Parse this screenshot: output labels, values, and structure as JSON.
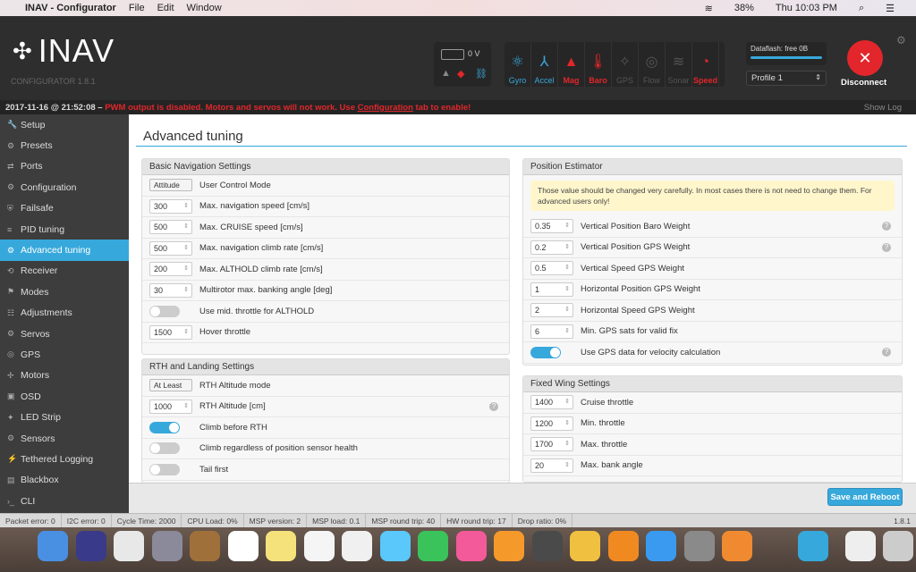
{
  "menubar": {
    "app": "INAV - Configurator",
    "items": [
      "File",
      "Edit",
      "Window"
    ],
    "battery": "38%",
    "clock": "Thu 10:03 PM"
  },
  "header": {
    "logo": "INAV",
    "subtitle": "CONFIGURATOR  1.8.1",
    "voltage": "0 V",
    "sensors": [
      {
        "label": "Gyro",
        "color": "#37a8db",
        "icon": "atom-icon",
        "glyph": "⚛"
      },
      {
        "label": "Accel",
        "color": "#37a8db",
        "icon": "axes-icon",
        "glyph": "⅄"
      },
      {
        "label": "Mag",
        "color": "#e2262b",
        "icon": "compass-n-icon",
        "glyph": "▲"
      },
      {
        "label": "Baro",
        "color": "#e2262b",
        "icon": "thermometer-icon",
        "glyph": "🌡"
      },
      {
        "label": "GPS",
        "color": "#555",
        "icon": "satellite-icon",
        "glyph": "✧"
      },
      {
        "label": "Flow",
        "color": "#555",
        "icon": "flow-icon",
        "glyph": "◎"
      },
      {
        "label": "Sonar",
        "color": "#555",
        "icon": "sonar-icon",
        "glyph": "≋"
      },
      {
        "label": "Speed",
        "color": "#e2262b",
        "icon": "speedometer-icon",
        "glyph": "◔"
      }
    ],
    "dataflash": "Dataflash: free 0B",
    "dataflash_fill": 1.0,
    "profile": "Profile 1",
    "disconnect": "Disconnect"
  },
  "log": {
    "timestamp": "2017-11-16 @ 21:52:08 –",
    "warning": "PWM output is disabled. Motors and servos will not work. Use",
    "link": "Configuration",
    "warning_end": "tab to enable!",
    "show_log": "Show Log"
  },
  "sidebar": {
    "items": [
      "Setup",
      "Presets",
      "Ports",
      "Configuration",
      "Failsafe",
      "PID tuning",
      "Advanced tuning",
      "Receiver",
      "Modes",
      "Adjustments",
      "Servos",
      "GPS",
      "Motors",
      "OSD",
      "LED Strip",
      "Sensors",
      "Tethered Logging",
      "Blackbox",
      "CLI"
    ],
    "active": 6
  },
  "page": {
    "title": "Advanced tuning",
    "save": "Save and Reboot"
  },
  "nav_settings": {
    "title": "Basic Navigation Settings",
    "rows": [
      {
        "type": "select",
        "value": "Attitude",
        "label": "User Control Mode"
      },
      {
        "type": "input",
        "value": "300",
        "label": "Max. navigation speed [cm/s]"
      },
      {
        "type": "input",
        "value": "500",
        "label": "Max. CRUISE speed [cm/s]"
      },
      {
        "type": "input",
        "value": "500",
        "label": "Max. navigation climb rate [cm/s]"
      },
      {
        "type": "input",
        "value": "200",
        "label": "Max. ALTHOLD climb rate [cm/s]"
      },
      {
        "type": "input",
        "value": "30",
        "label": "Multirotor max. banking angle [deg]"
      },
      {
        "type": "toggle",
        "on": false,
        "label": "Use mid. throttle for ALTHOLD"
      },
      {
        "type": "input",
        "value": "1500",
        "label": "Hover throttle"
      }
    ]
  },
  "rth_settings": {
    "title": "RTH and Landing Settings",
    "rows": [
      {
        "type": "select",
        "value": "At Least",
        "label": "RTH Altitude mode"
      },
      {
        "type": "input",
        "value": "1000",
        "label": "RTH Altitude [cm]",
        "help": true
      },
      {
        "type": "toggle",
        "on": true,
        "label": "Climb before RTH"
      },
      {
        "type": "toggle",
        "on": false,
        "label": "Climb regardless of position sensor health"
      },
      {
        "type": "toggle",
        "on": false,
        "label": "Tail first"
      }
    ]
  },
  "pos_estimator": {
    "title": "Position Estimator",
    "note": "Those value should be changed very carefully. In most cases there is not need to change them. For advanced users only!",
    "rows": [
      {
        "type": "input",
        "value": "0.35",
        "label": "Vertical Position Baro Weight",
        "help": true
      },
      {
        "type": "input",
        "value": "0.2",
        "label": "Vertical Position GPS Weight",
        "help": true
      },
      {
        "type": "input",
        "value": "0.5",
        "label": "Vertical Speed GPS Weight"
      },
      {
        "type": "input",
        "value": "1",
        "label": "Horizontal Position GPS Weight"
      },
      {
        "type": "input",
        "value": "2",
        "label": "Horizontal Speed GPS Weight"
      },
      {
        "type": "input",
        "value": "6",
        "label": "Min. GPS sats for valid fix"
      },
      {
        "type": "toggle",
        "on": true,
        "label": "Use GPS data for velocity calculation",
        "help": true
      }
    ]
  },
  "fixed_wing": {
    "title": "Fixed Wing Settings",
    "rows": [
      {
        "type": "input",
        "value": "1400",
        "label": "Cruise throttle"
      },
      {
        "type": "input",
        "value": "1200",
        "label": "Min. throttle"
      },
      {
        "type": "input",
        "value": "1700",
        "label": "Max. throttle"
      },
      {
        "type": "input",
        "value": "20",
        "label": "Max. bank angle"
      }
    ]
  },
  "statusbar": {
    "items": [
      "Packet error: 0",
      "I2C error: 0",
      "Cycle Time: 2000",
      "CPU Load: 0%",
      "MSP version: 2",
      "MSP load: 0.1",
      "MSP round trip: 40",
      "HW round trip: 17",
      "Drop ratio: 0%"
    ],
    "version": "1.8.1"
  },
  "dock": [
    {
      "name": "finder",
      "color": "#4a90e2"
    },
    {
      "name": "siri",
      "color": "#3a3a8a"
    },
    {
      "name": "chrome",
      "color": "#e8e8e8"
    },
    {
      "name": "launchpad",
      "color": "#8a8a9a"
    },
    {
      "name": "notebook",
      "color": "#a0703a"
    },
    {
      "name": "calendar",
      "color": "#ffffff"
    },
    {
      "name": "notes",
      "color": "#f5e27a"
    },
    {
      "name": "reminders",
      "color": "#f5f5f5"
    },
    {
      "name": "photos",
      "color": "#f0f0f0"
    },
    {
      "name": "messages",
      "color": "#5ac8fa"
    },
    {
      "name": "facetime",
      "color": "#3ac35a"
    },
    {
      "name": "itunes",
      "color": "#f25a9a"
    },
    {
      "name": "ibooks",
      "color": "#f59a2a"
    },
    {
      "name": "sublime",
      "color": "#4a4a4a"
    },
    {
      "name": "cyberduck",
      "color": "#f0c040"
    },
    {
      "name": "vlc",
      "color": "#f08a20"
    },
    {
      "name": "appstore",
      "color": "#3a9af0"
    },
    {
      "name": "system-preferences",
      "color": "#8a8a8a"
    },
    {
      "name": "fusion360",
      "color": "#f08a30"
    },
    {
      "name": "inav",
      "color": "#37a8db"
    },
    {
      "name": "zip-file",
      "color": "#eeeeee"
    },
    {
      "name": "trash",
      "color": "#cccccc"
    }
  ]
}
